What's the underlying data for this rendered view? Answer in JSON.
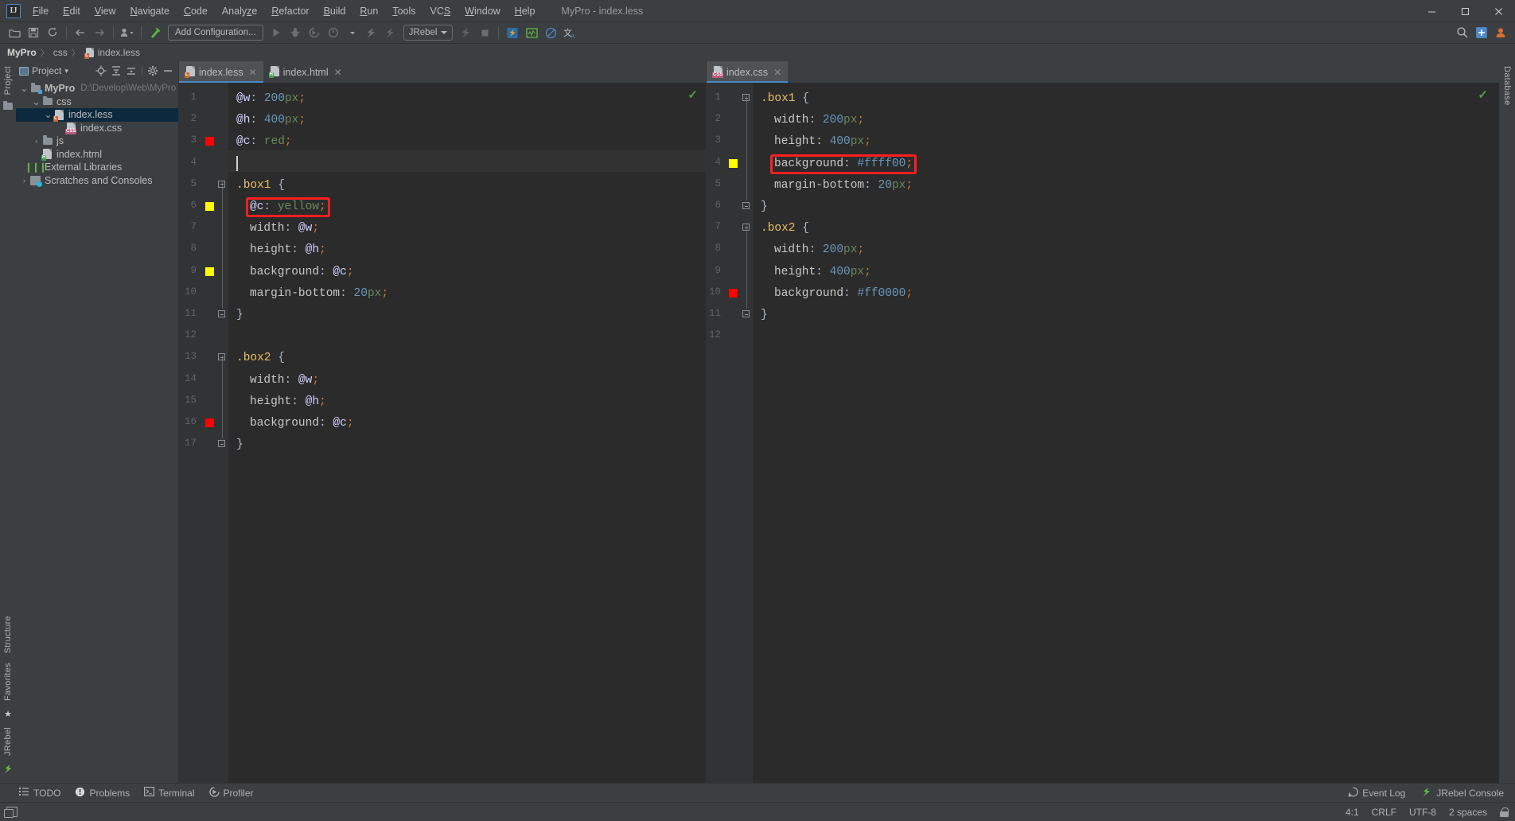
{
  "window": {
    "title": "MyPro - index.less",
    "logo_text": "IJ",
    "controls": [
      {
        "name": "minimize",
        "glyph": "—"
      },
      {
        "name": "maximize",
        "glyph": "☐"
      },
      {
        "name": "close",
        "glyph": "✕"
      }
    ]
  },
  "menu": [
    {
      "label": "File",
      "mnemonic": "F"
    },
    {
      "label": "Edit",
      "mnemonic": "E"
    },
    {
      "label": "View",
      "mnemonic": "V"
    },
    {
      "label": "Navigate",
      "mnemonic": "N"
    },
    {
      "label": "Code",
      "mnemonic": "C"
    },
    {
      "label": "Analyze",
      "mnemonic": "z"
    },
    {
      "label": "Refactor",
      "mnemonic": "R"
    },
    {
      "label": "Build",
      "mnemonic": "B"
    },
    {
      "label": "Run",
      "mnemonic": "R"
    },
    {
      "label": "Tools",
      "mnemonic": "T"
    },
    {
      "label": "VCS",
      "mnemonic": "S"
    },
    {
      "label": "Window",
      "mnemonic": "W"
    },
    {
      "label": "Help",
      "mnemonic": "H"
    }
  ],
  "toolbar": {
    "run_config_label": "Add Configuration...",
    "jrebel_label": "JRebel",
    "icons_left": [
      "open-folder-icon",
      "save-all-icon",
      "sync-icon",
      "back-arrow-icon",
      "forward-arrow-icon",
      "profile-dropdown-icon",
      "build-hammer-icon"
    ],
    "icons_run": [
      "run-icon",
      "debug-icon",
      "run-coverage-icon",
      "profile-run-icon",
      "jrebel-run-icon",
      "jrebel-debug-icon"
    ],
    "icons_after": [
      "jrebel-stop-icon",
      "stop-icon"
    ],
    "icons_right": [
      "jrebel-toolbar-icon",
      "monitor-icon",
      "forbidden-icon",
      "translate-icon",
      "search-everywhere-icon",
      "settings-plugin-icon",
      "user-account-icon"
    ]
  },
  "breadcrumb": {
    "project": "MyPro",
    "folder": "css",
    "file": "index.less",
    "separator": "〉"
  },
  "project_panel": {
    "title": "Project",
    "dropdown_glyph": "▾",
    "actions": [
      "locate-target-icon",
      "expand-all-icon",
      "collapse-all-icon",
      "settings-gear-icon",
      "hide-panel-icon"
    ],
    "tree": [
      {
        "depth": 0,
        "arrow": "⌄",
        "icon": "folder-module",
        "label": "MyPro",
        "bold": true,
        "path": "D:\\Develop\\Web\\MyPro",
        "selected": false
      },
      {
        "depth": 1,
        "arrow": "⌄",
        "icon": "folder",
        "label": "css",
        "bold": false,
        "path": "",
        "selected": false
      },
      {
        "depth": 2,
        "arrow": "⌄",
        "icon": "file-less",
        "badge": "L",
        "badge_color": "#cc6633",
        "label": "index.less",
        "bold": false,
        "path": "",
        "selected": true
      },
      {
        "depth": 3,
        "arrow": "",
        "icon": "file-css",
        "badge": "CSS",
        "badge_color": "#b85c7a",
        "label": "index.css",
        "bold": false,
        "path": "",
        "selected": false
      },
      {
        "depth": 1,
        "arrow": "›",
        "icon": "folder",
        "label": "js",
        "bold": false,
        "path": "",
        "selected": false
      },
      {
        "depth": 1,
        "arrow": "",
        "icon": "file-html",
        "badge": "H",
        "badge_color": "#499c54",
        "label": "index.html",
        "bold": false,
        "path": "",
        "selected": false
      },
      {
        "depth": 0,
        "arrow": "",
        "icon": "libraries",
        "label": "External Libraries",
        "bold": false,
        "path": "",
        "selected": false
      },
      {
        "depth": 0,
        "arrow": "›",
        "icon": "scratches",
        "label": "Scratches and Consoles",
        "bold": false,
        "path": "",
        "selected": false
      }
    ]
  },
  "rails": {
    "left_top": "Project",
    "left_bottom": [
      "Structure",
      "Favorites",
      "JRebel"
    ],
    "right": "Database"
  },
  "editor_left": {
    "tabs": [
      {
        "label": "index.less",
        "badge": "L",
        "badge_color": "#cc6633",
        "active": true,
        "closable": true
      },
      {
        "label": "index.html",
        "badge": "H",
        "badge_color": "#499c54",
        "active": false,
        "closable": true
      }
    ],
    "inspection_status": "✓",
    "caret_line": 4,
    "highlight_line": 6,
    "lines": [
      {
        "n": 1,
        "mark": null,
        "fold": null,
        "indent": 0,
        "tokens": [
          {
            "t": "@w",
            "c": "t-at"
          },
          {
            "t": ": ",
            "c": "t-plain"
          },
          {
            "t": "200",
            "c": "t-num"
          },
          {
            "t": "px",
            "c": "t-unit"
          },
          {
            "t": ";",
            "c": "t-punc"
          }
        ]
      },
      {
        "n": 2,
        "mark": null,
        "fold": null,
        "indent": 0,
        "tokens": [
          {
            "t": "@h",
            "c": "t-at"
          },
          {
            "t": ": ",
            "c": "t-plain"
          },
          {
            "t": "400",
            "c": "t-num"
          },
          {
            "t": "px",
            "c": "t-unit"
          },
          {
            "t": ";",
            "c": "t-punc"
          }
        ]
      },
      {
        "n": 3,
        "mark": "#ff0000",
        "fold": null,
        "indent": 0,
        "tokens": [
          {
            "t": "@c",
            "c": "t-at"
          },
          {
            "t": ": ",
            "c": "t-plain"
          },
          {
            "t": "red",
            "c": "t-kw"
          },
          {
            "t": ";",
            "c": "t-punc"
          }
        ]
      },
      {
        "n": 4,
        "mark": null,
        "fold": null,
        "indent": 0,
        "tokens": []
      },
      {
        "n": 5,
        "mark": null,
        "fold": "open",
        "indent": 0,
        "tokens": [
          {
            "t": ".box1",
            "c": "t-sel"
          },
          {
            "t": " {",
            "c": "t-brace"
          }
        ]
      },
      {
        "n": 6,
        "mark": "#ffff00",
        "fold": null,
        "indent": 1,
        "tokens": [
          {
            "t": "@c",
            "c": "t-at"
          },
          {
            "t": ": ",
            "c": "t-plain"
          },
          {
            "t": "yellow",
            "c": "t-kw"
          },
          {
            "t": ";",
            "c": "t-punc"
          }
        ]
      },
      {
        "n": 7,
        "mark": null,
        "fold": null,
        "indent": 1,
        "tokens": [
          {
            "t": "width",
            "c": "t-prop"
          },
          {
            "t": ": ",
            "c": "t-plain"
          },
          {
            "t": "@w",
            "c": "t-at"
          },
          {
            "t": ";",
            "c": "t-punc"
          }
        ]
      },
      {
        "n": 8,
        "mark": null,
        "fold": null,
        "indent": 1,
        "tokens": [
          {
            "t": "height",
            "c": "t-prop"
          },
          {
            "t": ": ",
            "c": "t-plain"
          },
          {
            "t": "@h",
            "c": "t-at"
          },
          {
            "t": ";",
            "c": "t-punc"
          }
        ]
      },
      {
        "n": 9,
        "mark": "#ffff00",
        "fold": null,
        "indent": 1,
        "tokens": [
          {
            "t": "background",
            "c": "t-prop"
          },
          {
            "t": ": ",
            "c": "t-plain"
          },
          {
            "t": "@c",
            "c": "t-at"
          },
          {
            "t": ";",
            "c": "t-punc"
          }
        ]
      },
      {
        "n": 10,
        "mark": null,
        "fold": null,
        "indent": 1,
        "tokens": [
          {
            "t": "margin-bottom",
            "c": "t-prop"
          },
          {
            "t": ": ",
            "c": "t-plain"
          },
          {
            "t": "20",
            "c": "t-num"
          },
          {
            "t": "px",
            "c": "t-unit"
          },
          {
            "t": ";",
            "c": "t-punc"
          }
        ]
      },
      {
        "n": 11,
        "mark": null,
        "fold": "close",
        "indent": 0,
        "tokens": [
          {
            "t": "}",
            "c": "t-brace"
          }
        ]
      },
      {
        "n": 12,
        "mark": null,
        "fold": null,
        "indent": 0,
        "tokens": []
      },
      {
        "n": 13,
        "mark": null,
        "fold": "open",
        "indent": 0,
        "tokens": [
          {
            "t": ".box2",
            "c": "t-sel"
          },
          {
            "t": " {",
            "c": "t-brace"
          }
        ]
      },
      {
        "n": 14,
        "mark": null,
        "fold": null,
        "indent": 1,
        "tokens": [
          {
            "t": "width",
            "c": "t-prop"
          },
          {
            "t": ": ",
            "c": "t-plain"
          },
          {
            "t": "@w",
            "c": "t-at"
          },
          {
            "t": ";",
            "c": "t-punc"
          }
        ]
      },
      {
        "n": 15,
        "mark": null,
        "fold": null,
        "indent": 1,
        "tokens": [
          {
            "t": "height",
            "c": "t-prop"
          },
          {
            "t": ": ",
            "c": "t-plain"
          },
          {
            "t": "@h",
            "c": "t-at"
          },
          {
            "t": ";",
            "c": "t-punc"
          }
        ]
      },
      {
        "n": 16,
        "mark": "#ff0000",
        "fold": null,
        "indent": 1,
        "tokens": [
          {
            "t": "background",
            "c": "t-prop"
          },
          {
            "t": ": ",
            "c": "t-plain"
          },
          {
            "t": "@c",
            "c": "t-at"
          },
          {
            "t": ";",
            "c": "t-punc"
          }
        ]
      },
      {
        "n": 17,
        "mark": null,
        "fold": "close",
        "indent": 0,
        "tokens": [
          {
            "t": "}",
            "c": "t-brace"
          }
        ]
      }
    ],
    "source_text": "@w: 200px;\n@h: 400px;\n@c: red;\n\n.box1 {\n  @c: yellow;\n  width: @w;\n  height: @h;\n  background: @c;\n  margin-bottom: 20px;\n}\n\n.box2 {\n  width: @w;\n  height: @h;\n  background: @c;\n}"
  },
  "editor_right": {
    "tabs": [
      {
        "label": "index.css",
        "badge": "CSS",
        "badge_color": "#b85c7a",
        "active": true,
        "closable": true
      }
    ],
    "inspection_status": "✓",
    "highlight_line": 4,
    "lines": [
      {
        "n": 1,
        "mark": null,
        "fold": "open",
        "indent": 0,
        "tokens": [
          {
            "t": ".box1",
            "c": "t-sel"
          },
          {
            "t": " {",
            "c": "t-brace"
          }
        ]
      },
      {
        "n": 2,
        "mark": null,
        "fold": null,
        "indent": 1,
        "tokens": [
          {
            "t": "width",
            "c": "t-prop"
          },
          {
            "t": ": ",
            "c": "t-plain"
          },
          {
            "t": "200",
            "c": "t-num"
          },
          {
            "t": "px",
            "c": "t-unit"
          },
          {
            "t": ";",
            "c": "t-punc"
          }
        ]
      },
      {
        "n": 3,
        "mark": null,
        "fold": null,
        "indent": 1,
        "tokens": [
          {
            "t": "height",
            "c": "t-prop"
          },
          {
            "t": ": ",
            "c": "t-plain"
          },
          {
            "t": "400",
            "c": "t-num"
          },
          {
            "t": "px",
            "c": "t-unit"
          },
          {
            "t": ";",
            "c": "t-punc"
          }
        ]
      },
      {
        "n": 4,
        "mark": "#ffff00",
        "fold": null,
        "indent": 1,
        "tokens": [
          {
            "t": "background",
            "c": "t-prop"
          },
          {
            "t": ": ",
            "c": "t-plain"
          },
          {
            "t": "#ffff00",
            "c": "t-hex"
          },
          {
            "t": ";",
            "c": "t-punc"
          }
        ]
      },
      {
        "n": 5,
        "mark": null,
        "fold": null,
        "indent": 1,
        "tokens": [
          {
            "t": "margin-bottom",
            "c": "t-prop"
          },
          {
            "t": ": ",
            "c": "t-plain"
          },
          {
            "t": "20",
            "c": "t-num"
          },
          {
            "t": "px",
            "c": "t-unit"
          },
          {
            "t": ";",
            "c": "t-punc"
          }
        ]
      },
      {
        "n": 6,
        "mark": null,
        "fold": "close",
        "indent": 0,
        "tokens": [
          {
            "t": "}",
            "c": "t-brace"
          }
        ]
      },
      {
        "n": 7,
        "mark": null,
        "fold": "open",
        "indent": 0,
        "tokens": [
          {
            "t": ".box2",
            "c": "t-sel"
          },
          {
            "t": " {",
            "c": "t-brace"
          }
        ]
      },
      {
        "n": 8,
        "mark": null,
        "fold": null,
        "indent": 1,
        "tokens": [
          {
            "t": "width",
            "c": "t-prop"
          },
          {
            "t": ": ",
            "c": "t-plain"
          },
          {
            "t": "200",
            "c": "t-num"
          },
          {
            "t": "px",
            "c": "t-unit"
          },
          {
            "t": ";",
            "c": "t-punc"
          }
        ]
      },
      {
        "n": 9,
        "mark": null,
        "fold": null,
        "indent": 1,
        "tokens": [
          {
            "t": "height",
            "c": "t-prop"
          },
          {
            "t": ": ",
            "c": "t-plain"
          },
          {
            "t": "400",
            "c": "t-num"
          },
          {
            "t": "px",
            "c": "t-unit"
          },
          {
            "t": ";",
            "c": "t-punc"
          }
        ]
      },
      {
        "n": 10,
        "mark": "#ff0000",
        "fold": null,
        "indent": 1,
        "tokens": [
          {
            "t": "background",
            "c": "t-prop"
          },
          {
            "t": ": ",
            "c": "t-plain"
          },
          {
            "t": "#ff0000",
            "c": "t-hex"
          },
          {
            "t": ";",
            "c": "t-punc"
          }
        ]
      },
      {
        "n": 11,
        "mark": null,
        "fold": "close",
        "indent": 0,
        "tokens": [
          {
            "t": "}",
            "c": "t-brace"
          }
        ]
      },
      {
        "n": 12,
        "mark": null,
        "fold": null,
        "indent": 0,
        "tokens": []
      }
    ],
    "source_text": ".box1 {\n  width: 200px;\n  height: 400px;\n  background: #ffff00;\n  margin-bottom: 20px;\n}\n.box2 {\n  width: 200px;\n  height: 400px;\n  background: #ff0000;\n}\n"
  },
  "tool_windows": [
    {
      "label": "TODO",
      "icon": "todo-list-icon"
    },
    {
      "label": "Problems",
      "icon": "problems-warning-icon"
    },
    {
      "label": "Terminal",
      "icon": "terminal-icon"
    },
    {
      "label": "Profiler",
      "icon": "profiler-icon"
    }
  ],
  "tool_windows_right": [
    {
      "label": "Event Log",
      "icon": "event-log-icon"
    },
    {
      "label": "JRebel Console",
      "icon": "jrebel-icon"
    }
  ],
  "status_bar": {
    "caret_position": "4:1",
    "line_separator": "CRLF",
    "encoding": "UTF-8",
    "indent": "2 spaces",
    "lock_icon": "read-only-lock-icon"
  },
  "colors": {
    "accent": "#4a88c7",
    "panel_bg": "#3c3f41",
    "editor_bg": "#2b2b2b",
    "gutter_bg": "#313335",
    "selection": "#0d293e",
    "annotation_red": "#ff1f1f",
    "yellow_swatch": "#ffff00",
    "red_swatch": "#ff0000",
    "green_check": "#4d9e4d"
  }
}
